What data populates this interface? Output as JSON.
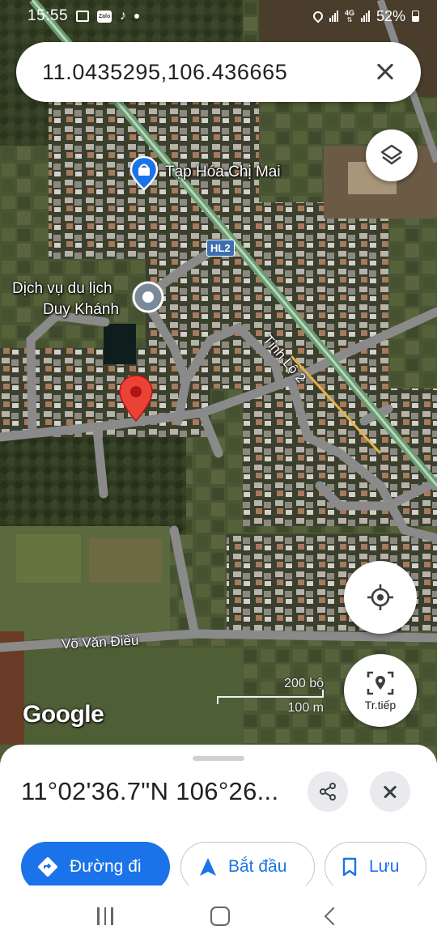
{
  "status_bar": {
    "time": "15:55",
    "network": "4G",
    "battery": "52%",
    "icons": [
      "gallery-icon",
      "zalo-icon",
      "tiktok-icon",
      "dot-icon",
      "location-icon",
      "signal-icon",
      "signal-4g-icon",
      "battery-icon"
    ]
  },
  "search": {
    "value": "11.0435295,106.436665",
    "clear_icon": "close-icon"
  },
  "map": {
    "places": [
      {
        "name": "Tạp Hóa Chị Mai",
        "icon": "shop-pin-icon"
      },
      {
        "name_line1": "Dịch vụ du lịch",
        "name_line2": "Duy Khánh",
        "icon": "place-pin-icon"
      }
    ],
    "roads": {
      "route_shield": "HL2",
      "provincial_road": "Tỉnh Lộ 2",
      "street": "Võ Văn Điều"
    },
    "logo": "Google",
    "scale": {
      "imperial": "200 bộ",
      "metric": "100 m"
    },
    "buttons": {
      "layers_icon": "layers-icon",
      "locate_icon": "my-location-icon",
      "navigate_label": "Tr.tiếp",
      "navigate_icon": "navigate-pin-icon"
    },
    "marker_color": "#ea4335"
  },
  "sheet": {
    "coordinates": "11°02'36.7\"N 106°26...",
    "share_icon": "share-icon",
    "close_icon": "close-icon",
    "actions": {
      "directions": "Đường đi",
      "start": "Bắt đầu",
      "save": "Lưu"
    },
    "accent_color": "#1a73e8"
  },
  "navbar": {
    "icons": [
      "recents-icon",
      "home-icon",
      "back-icon"
    ]
  }
}
